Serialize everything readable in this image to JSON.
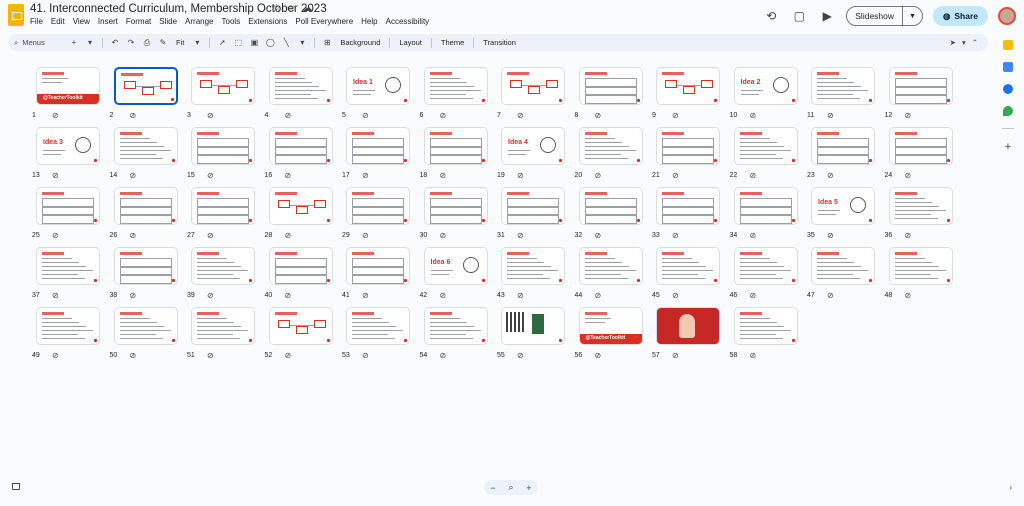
{
  "app": {
    "title": "41. Interconnected Curriculum, Membership October 2023",
    "menu": [
      "File",
      "Edit",
      "View",
      "Insert",
      "Format",
      "Slide",
      "Arrange",
      "Tools",
      "Extensions",
      "Poll Everywhere",
      "Help",
      "Accessibility"
    ],
    "slideshow_label": "Slideshow",
    "share_label": "Share"
  },
  "toolbar": {
    "menus_label": "Menus",
    "zoom_label": "Fit",
    "buttons": [
      "Background",
      "Layout",
      "Theme",
      "Transition"
    ]
  },
  "slides": [
    {
      "n": "1",
      "kind": "title",
      "text": "@TeacherToolkit"
    },
    {
      "n": "2",
      "kind": "diagram",
      "selected": true
    },
    {
      "n": "3",
      "kind": "diagram"
    },
    {
      "n": "4",
      "kind": "text"
    },
    {
      "n": "5",
      "kind": "idea",
      "text": "Idea 1"
    },
    {
      "n": "6",
      "kind": "text"
    },
    {
      "n": "7",
      "kind": "diagram"
    },
    {
      "n": "8",
      "kind": "table"
    },
    {
      "n": "9",
      "kind": "diagram"
    },
    {
      "n": "10",
      "kind": "idea",
      "text": "Idea 2"
    },
    {
      "n": "11",
      "kind": "text"
    },
    {
      "n": "12",
      "kind": "table"
    },
    {
      "n": "13",
      "kind": "idea",
      "text": "Idea 3"
    },
    {
      "n": "14",
      "kind": "text"
    },
    {
      "n": "15",
      "kind": "table"
    },
    {
      "n": "16",
      "kind": "table"
    },
    {
      "n": "17",
      "kind": "table"
    },
    {
      "n": "18",
      "kind": "table"
    },
    {
      "n": "19",
      "kind": "idea",
      "text": "Idea 4"
    },
    {
      "n": "20",
      "kind": "text"
    },
    {
      "n": "21",
      "kind": "table"
    },
    {
      "n": "22",
      "kind": "text"
    },
    {
      "n": "23",
      "kind": "table"
    },
    {
      "n": "24",
      "kind": "table"
    },
    {
      "n": "25",
      "kind": "table"
    },
    {
      "n": "26",
      "kind": "table"
    },
    {
      "n": "27",
      "kind": "table"
    },
    {
      "n": "28",
      "kind": "diagram"
    },
    {
      "n": "29",
      "kind": "table"
    },
    {
      "n": "30",
      "kind": "table"
    },
    {
      "n": "31",
      "kind": "table"
    },
    {
      "n": "32",
      "kind": "table"
    },
    {
      "n": "33",
      "kind": "table"
    },
    {
      "n": "34",
      "kind": "table"
    },
    {
      "n": "35",
      "kind": "idea",
      "text": "Idea 5"
    },
    {
      "n": "36",
      "kind": "text"
    },
    {
      "n": "37",
      "kind": "text"
    },
    {
      "n": "38",
      "kind": "table"
    },
    {
      "n": "39",
      "kind": "text"
    },
    {
      "n": "40",
      "kind": "table"
    },
    {
      "n": "41",
      "kind": "table"
    },
    {
      "n": "42",
      "kind": "idea",
      "text": "Idea 6"
    },
    {
      "n": "43",
      "kind": "text"
    },
    {
      "n": "44",
      "kind": "text"
    },
    {
      "n": "45",
      "kind": "text"
    },
    {
      "n": "46",
      "kind": "text"
    },
    {
      "n": "47",
      "kind": "text"
    },
    {
      "n": "48",
      "kind": "text"
    },
    {
      "n": "49",
      "kind": "text"
    },
    {
      "n": "50",
      "kind": "text"
    },
    {
      "n": "51",
      "kind": "text"
    },
    {
      "n": "52",
      "kind": "diagram"
    },
    {
      "n": "53",
      "kind": "text"
    },
    {
      "n": "54",
      "kind": "text"
    },
    {
      "n": "55",
      "kind": "qr"
    },
    {
      "n": "56",
      "kind": "title",
      "text": "@TeacherToolkit"
    },
    {
      "n": "57",
      "kind": "photo"
    },
    {
      "n": "58",
      "kind": "text"
    }
  ],
  "colors": {
    "accent": "#d93025",
    "selected": "#0b57d0",
    "share_bg": "#c2e7ff"
  }
}
